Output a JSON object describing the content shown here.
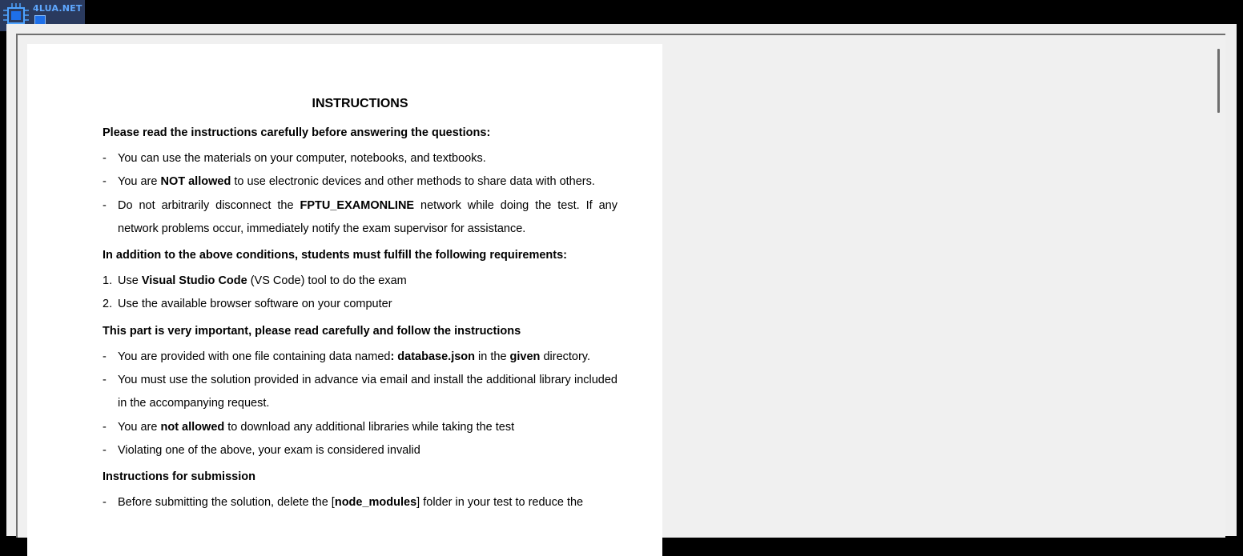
{
  "logo": {
    "brand_text": "4LUA.NET"
  },
  "document": {
    "title": "INSTRUCTIONS",
    "intro_heading": "Please read the instructions carefully before answering the questions:",
    "rules": [
      {
        "marker": "-",
        "a": "You can use the materials on your computer, notebooks, and textbooks.",
        "b": "",
        "c": "",
        "d": ""
      },
      {
        "marker": "-",
        "a": "You are ",
        "b": "NOT allowed",
        "c": " to use electronic devices and other methods to share data with others.",
        "d": ""
      },
      {
        "marker": "-",
        "a": "Do not arbitrarily disconnect the ",
        "b": "FPTU_EXAMONLINE",
        "c": " network while doing the test. If any network problems occur, immediately notify the exam supervisor for assistance.",
        "d": ""
      }
    ],
    "requirements_heading": "In addition to the above conditions, students must fulfill the following requirements:",
    "requirements": [
      {
        "marker": "1.",
        "a": "Use ",
        "b": "Visual Studio Code",
        "c": " (VS Code) tool to do the exam"
      },
      {
        "marker": "2.",
        "a": "Use the available browser software on your computer",
        "b": "",
        "c": ""
      }
    ],
    "important_heading": "This part is very important, please read carefully and follow the instructions",
    "important": [
      {
        "marker": "-",
        "a": "You are provided with one file containing data named",
        "b": ": database.json",
        "c": " in the ",
        "d": "given",
        "e": " directory."
      },
      {
        "marker": "-",
        "a": "You must use the solution provided in advance via email and install the additional library included in the accompanying request.",
        "b": "",
        "c": "",
        "d": "",
        "e": ""
      },
      {
        "marker": "-",
        "a": "You are ",
        "b": "not allowed",
        "c": " to download any additional libraries while taking the test",
        "d": "",
        "e": ""
      },
      {
        "marker": "-",
        "a": "Violating one of the above, your exam is considered invalid",
        "b": "",
        "c": "",
        "d": "",
        "e": ""
      }
    ],
    "submission_heading": "Instructions for submission",
    "submission": [
      {
        "marker": "-",
        "a": "Before submitting the solution, delete the [",
        "b": "node_modules",
        "c": "] folder in your test to reduce the"
      }
    ]
  }
}
